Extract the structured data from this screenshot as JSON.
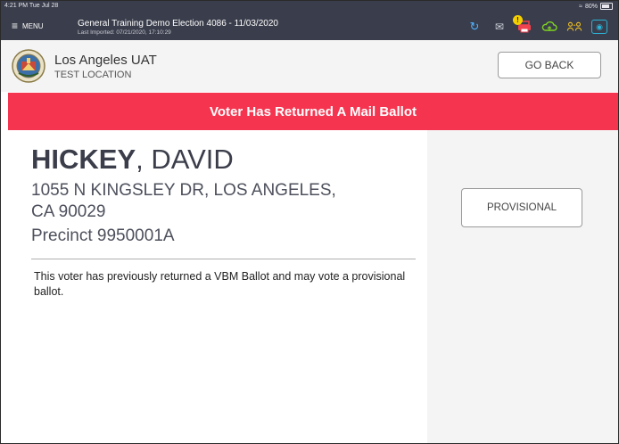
{
  "status_bar": {
    "time": "4:21 PM  Tue Jul 28",
    "battery": "80%"
  },
  "app_bar": {
    "menu_label": "MENU",
    "election_title": "General Training  Demo Election 4086 - 11/03/2020",
    "last_imported": "Last Imported: 07/21/2020, 17:10:29",
    "icons": [
      "history-icon",
      "mail-icon",
      "printer-warning-icon",
      "cloud-sync-icon",
      "users-icon",
      "support-icon"
    ],
    "warning_badge": "!"
  },
  "location": {
    "name": "Los Angeles UAT",
    "sub": "TEST LOCATION",
    "go_back_label": "GO BACK"
  },
  "banner": {
    "text": "Voter Has Returned A Mail Ballot",
    "color": "#f53550"
  },
  "voter": {
    "last_name": "HICKEY",
    "first_name": ", DAVID",
    "address_line1": "1055 N KINGSLEY DR, LOS ANGELES,",
    "address_line2": "CA 90029",
    "precinct": "Precinct 9950001A"
  },
  "message": "This voter has previously returned a VBM Ballot and may vote a provisional ballot.",
  "actions": {
    "provisional_label": "PROVISIONAL"
  }
}
